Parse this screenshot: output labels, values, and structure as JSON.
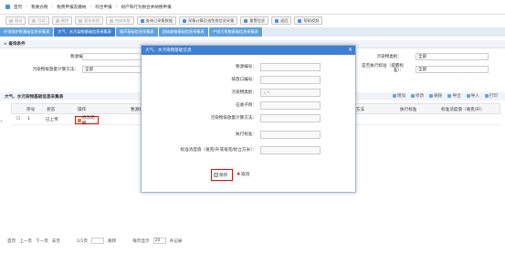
{
  "breadcrumb": [
    "首页",
    "我要办税",
    "税费申报及缴纳",
    "综合申报",
    "财产和行为税合并纳税申报"
  ],
  "toolbar": [
    {
      "label": "保存",
      "disabled": true
    },
    {
      "label": "打印",
      "disabled": true
    },
    {
      "label": "删除",
      "disabled": true
    },
    {
      "label": "暂存申报",
      "disabled": true
    },
    {
      "label": "完成申报",
      "disabled": true
    },
    {
      "label": "查询已采集数据",
      "disabled": false
    },
    {
      "label": "采集计算及减免税信息采集",
      "disabled": false
    },
    {
      "label": "重置信息",
      "disabled": false
    },
    {
      "label": "返回",
      "disabled": false
    },
    {
      "label": "帮助视频",
      "disabled": false
    }
  ],
  "tabs": [
    {
      "label": "环境保护税基础信息采集表",
      "active": false
    },
    {
      "label": "大气、水污染物基础信息采集表",
      "active": true
    },
    {
      "label": "噪声基础信息采集表",
      "active": false
    },
    {
      "label": "固体废物基础信息采集表",
      "active": false
    },
    {
      "label": "产排污系数基础信息采集表",
      "active": false
    }
  ],
  "query": {
    "title": "查询条件",
    "tax_id_label": "税源编号：",
    "pollutant_category_label": "污染物类别：",
    "pollutant_category_value": "全部",
    "calc_method_label": "污染物排放量计算方法：",
    "calc_method_value": "全部",
    "standard_label": "是否执行标准（提醒标准）：",
    "standard_value": "全部"
  },
  "grid": {
    "title": "大气、水污染物基础信息采集表",
    "tools": [
      "增加",
      "修改",
      "删除",
      "导出",
      "导入",
      "打印"
    ],
    "headers": [
      "序号",
      "状态",
      "操作",
      "税源编号",
      "污染物排放量计算方法",
      "执行标准",
      "标准浓度值（毫克/升）"
    ],
    "rows": [
      {
        "index": "1",
        "status": "已上传",
        "action": "修改明细"
      }
    ]
  },
  "pager": {
    "first": "首页",
    "prev": "上一页",
    "next": "下一页",
    "last": "末页",
    "page": "1/1页",
    "goto": "跳转",
    "per_page_label": "每页显示",
    "per_page_value": "20",
    "count": "条记录"
  },
  "modal": {
    "title": "大气、水污染物基础信息",
    "fields": [
      {
        "label": "税源编号：",
        "value": ""
      },
      {
        "label": "排放口编号：",
        "value": ""
      },
      {
        "label": "污染物类别：",
        "value": "大气"
      },
      {
        "label": "征收子目：",
        "value": ""
      },
      {
        "label": "污染物排放量计算方法：",
        "value": ""
      },
      {
        "label": "执行标准：",
        "value": ""
      },
      {
        "label": "标准浓度值（毫克/升或毫克/标立方米）：",
        "value": ""
      }
    ],
    "save_label": "保存",
    "cancel_label": "取消"
  }
}
